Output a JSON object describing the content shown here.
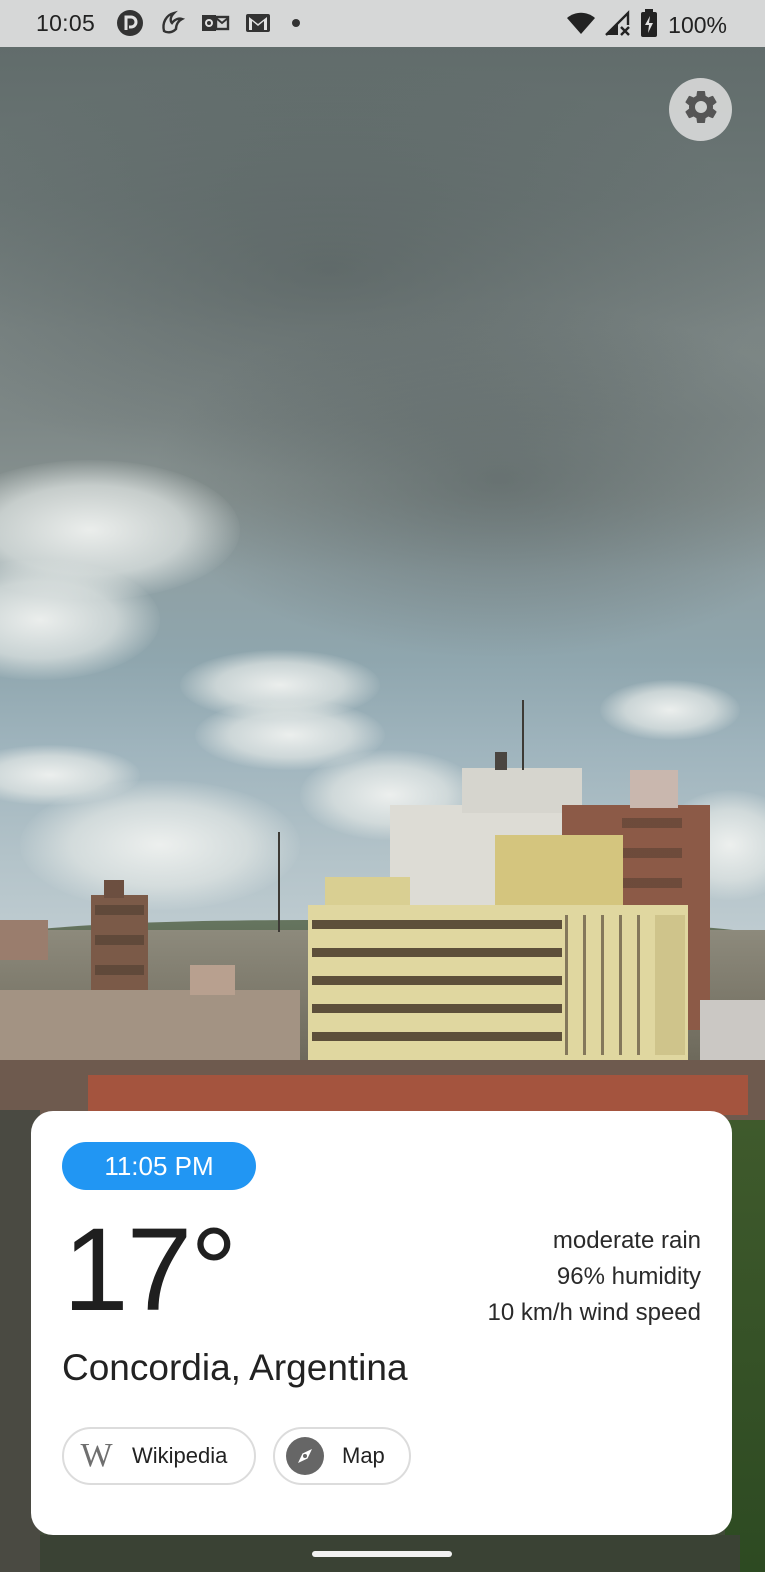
{
  "status_bar": {
    "time": "10:05",
    "battery_percent": "100%",
    "notification_icons": [
      "pocket-casts-icon",
      "bird-app-icon",
      "outlook-icon",
      "gmail-icon",
      "more-dot-icon"
    ],
    "system_icons": [
      "wifi-icon",
      "signal-icon",
      "battery-charging-icon"
    ]
  },
  "settings": {
    "icon": "gear-icon"
  },
  "weather": {
    "local_time": "11:05 PM",
    "temperature": "17°",
    "condition": "moderate rain",
    "humidity": "96% humidity",
    "wind": "10 km/h wind speed",
    "location": "Concordia, Argentina"
  },
  "links": {
    "wikipedia_label": "Wikipedia",
    "map_label": "Map",
    "wikipedia_icon_glyph": "W"
  },
  "colors": {
    "accent": "#2196f3",
    "card_bg": "#ffffff",
    "status_bar_bg": "#e1e1e1"
  }
}
